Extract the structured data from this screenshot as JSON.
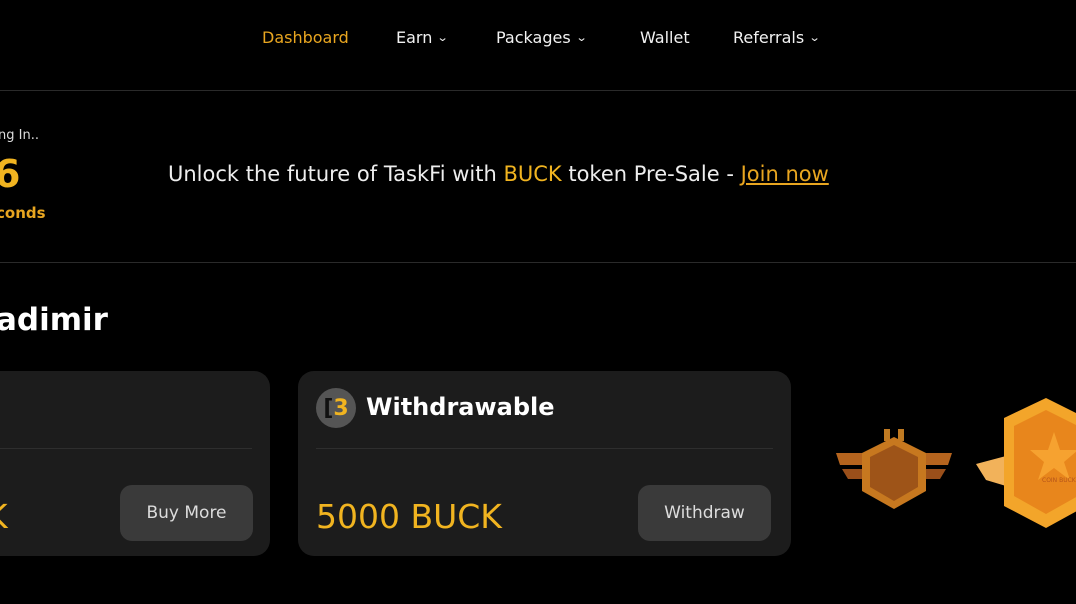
{
  "nav": {
    "items": [
      {
        "label": "Dashboard",
        "active": true,
        "dropdown": false
      },
      {
        "label": "Earn",
        "dropdown": true
      },
      {
        "label": "Packages",
        "dropdown": true
      },
      {
        "label": "Wallet",
        "dropdown": false
      },
      {
        "label": "Referrals",
        "dropdown": true
      }
    ]
  },
  "banner": {
    "ending_label": "ng In..",
    "count": "6",
    "unit": "conds",
    "promo_prefix": "Unlock the future of TaskFi with ",
    "promo_highlight": "BUCK",
    "promo_suffix": " token Pre-Sale - ",
    "promo_link": "Join now"
  },
  "greeting": "adimir",
  "cards": [
    {
      "amount": "K",
      "button": "Buy More"
    },
    {
      "title": "Withdrawable",
      "amount": "5000 BUCK",
      "button": "Withdraw",
      "icon": "buck-coin-icon"
    }
  ],
  "badges": [
    {
      "icon": "rank-badge-wings-icon"
    },
    {
      "icon": "rank-badge-star-icon",
      "text": "COIN BUCK"
    }
  ],
  "colors": {
    "accent": "#f1b420",
    "card": "#1c1c1c",
    "button": "#3a3a3a"
  }
}
